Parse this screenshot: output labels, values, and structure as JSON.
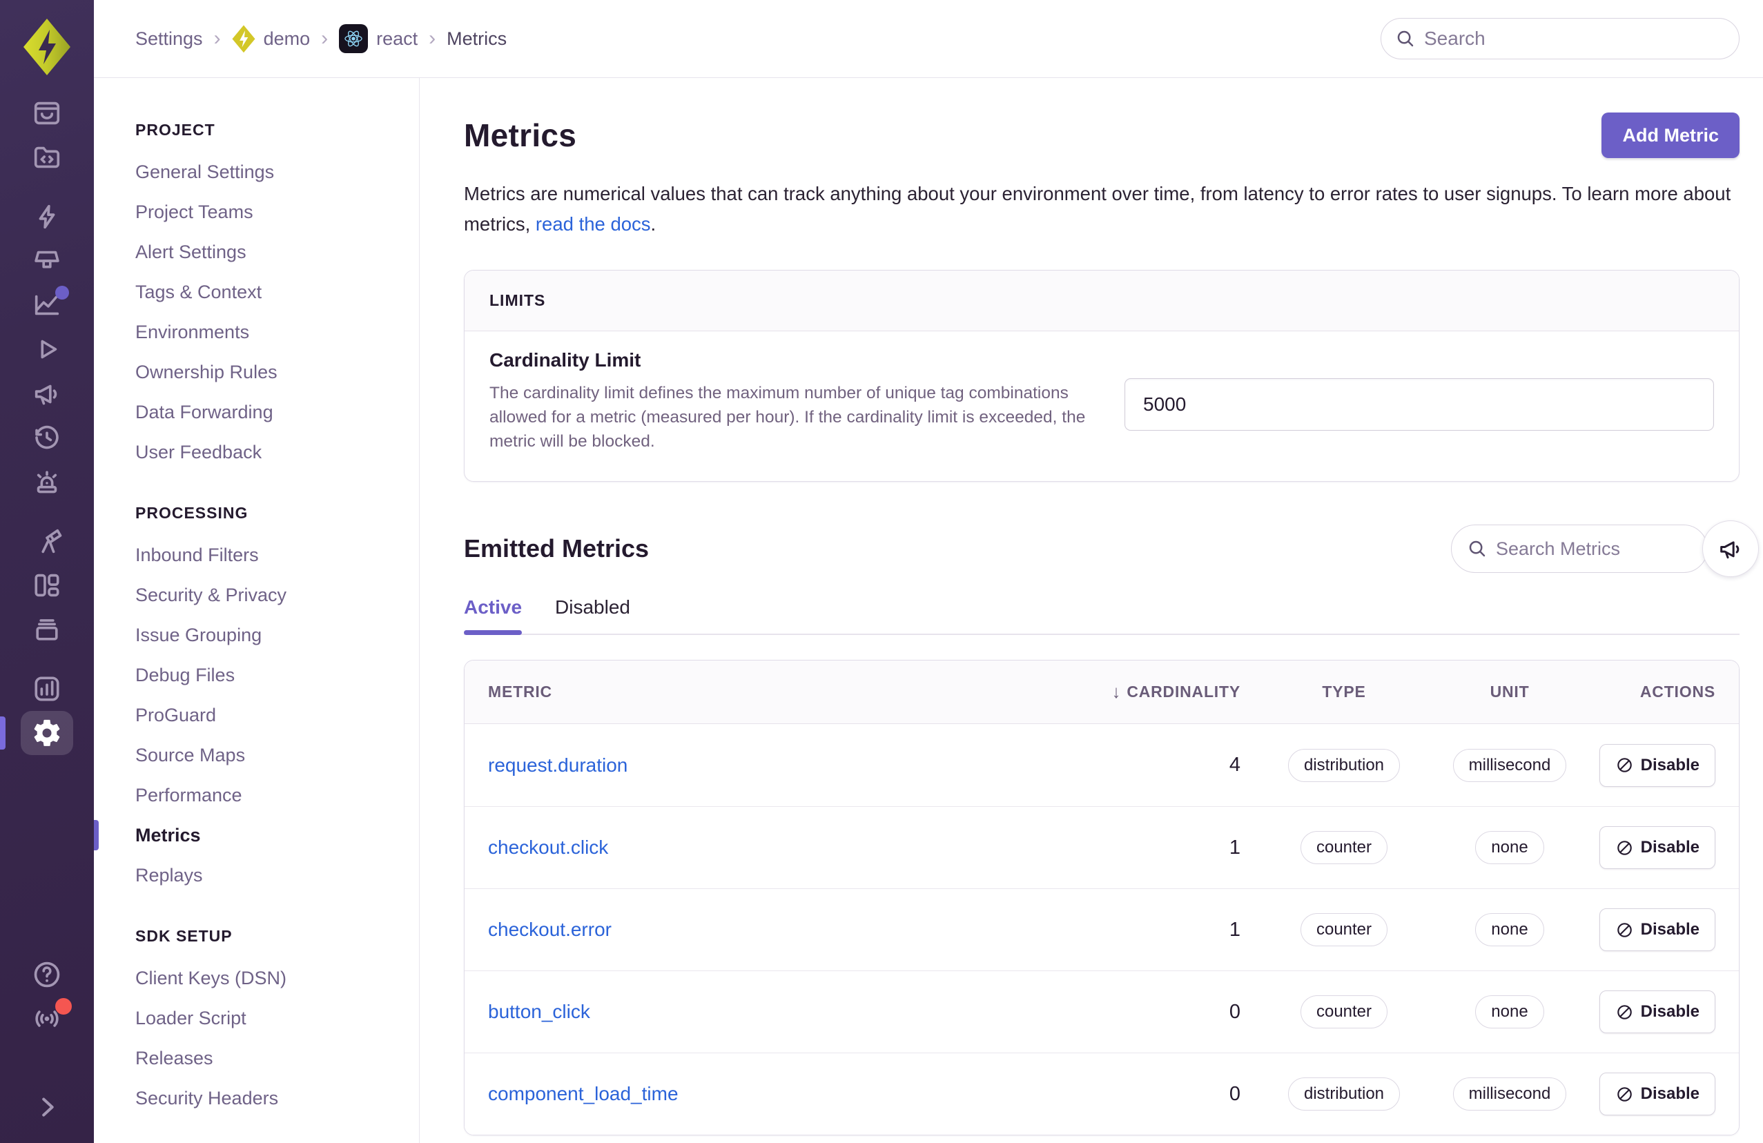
{
  "breadcrumb": {
    "settings": "Settings",
    "org": "demo",
    "project": "react",
    "page": "Metrics"
  },
  "topbar": {
    "search_placeholder": "Search"
  },
  "rail": {
    "icons": [
      "issues-inbox",
      "code-folder",
      "lightning",
      "projector",
      "line-chart",
      "play",
      "megaphone",
      "clock-history",
      "siren",
      "telescope",
      "layout-grid",
      "archive",
      "bar-chart-tile",
      "gear",
      "help",
      "broadcast",
      "chevron-right"
    ],
    "active_icon": "gear",
    "accent": "#6C5FC7",
    "alert_dot": "#f55651"
  },
  "sidebar": {
    "sections": [
      {
        "title": "PROJECT",
        "items": [
          "General Settings",
          "Project Teams",
          "Alert Settings",
          "Tags & Context",
          "Environments",
          "Ownership Rules",
          "Data Forwarding",
          "User Feedback"
        ]
      },
      {
        "title": "PROCESSING",
        "items": [
          "Inbound Filters",
          "Security & Privacy",
          "Issue Grouping",
          "Debug Files",
          "ProGuard",
          "Source Maps",
          "Performance",
          "Metrics",
          "Replays"
        ],
        "active_item": "Metrics"
      },
      {
        "title": "SDK SETUP",
        "items": [
          "Client Keys (DSN)",
          "Loader Script",
          "Releases",
          "Security Headers"
        ]
      }
    ]
  },
  "main": {
    "title": "Metrics",
    "add_button": "Add Metric",
    "description_before_link": "Metrics are numerical values that can track anything about your environment over time, from latency to error rates to user signups. To learn more about metrics, ",
    "description_link": "read the docs",
    "description_after_link": ".",
    "limits": {
      "header": "LIMITS",
      "field_label": "Cardinality Limit",
      "field_help": "The cardinality limit defines the maximum number of unique tag combinations allowed for a metric (measured per hour). If the cardinality limit is exceeded, the metric will be blocked.",
      "value": "5000"
    },
    "emitted": {
      "title": "Emitted Metrics",
      "search_placeholder": "Search Metrics",
      "tabs": [
        {
          "label": "Active",
          "selected": true
        },
        {
          "label": "Disabled",
          "selected": false
        }
      ],
      "table": {
        "columns": [
          "METRIC",
          "CARDINALITY",
          "TYPE",
          "UNIT",
          "ACTIONS"
        ],
        "sort_column": "CARDINALITY",
        "sort_direction": "desc",
        "rows": [
          {
            "metric": "request.duration",
            "cardinality": "4",
            "type": "distribution",
            "unit": "millisecond",
            "action": "Disable"
          },
          {
            "metric": "checkout.click",
            "cardinality": "1",
            "type": "counter",
            "unit": "none",
            "action": "Disable"
          },
          {
            "metric": "checkout.error",
            "cardinality": "1",
            "type": "counter",
            "unit": "none",
            "action": "Disable"
          },
          {
            "metric": "button_click",
            "cardinality": "0",
            "type": "counter",
            "unit": "none",
            "action": "Disable"
          },
          {
            "metric": "component_load_time",
            "cardinality": "0",
            "type": "distribution",
            "unit": "millisecond",
            "action": "Disable"
          }
        ]
      }
    }
  },
  "colors": {
    "accent_purple": "#6C5FC7",
    "link_blue": "#2b63d9",
    "rail_bg": "#3a2a50",
    "lime_logo": "#c9cf2b"
  }
}
